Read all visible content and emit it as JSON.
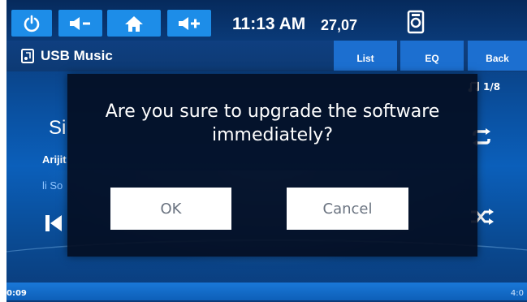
{
  "topbar": {
    "buttons": [
      {
        "name": "power-button",
        "icon": "power-icon"
      },
      {
        "name": "volume-down-button",
        "icon": "volume-down-icon"
      },
      {
        "name": "home-button",
        "icon": "home-icon"
      },
      {
        "name": "volume-up-button",
        "icon": "volume-up-icon"
      }
    ],
    "time": "11:13 AM",
    "temperature": "27,07",
    "device_icon": "media-device-icon"
  },
  "subbar": {
    "source_label": "USB Music",
    "source_icon": "music-file-icon",
    "tabs": [
      {
        "label": "List"
      },
      {
        "label": "EQ"
      },
      {
        "label": "Back"
      }
    ]
  },
  "player": {
    "track_count": "1/8",
    "title_partial": "Si",
    "artist_partial": "Arijit",
    "album_partial": "li So",
    "time_elapsed": "0:09",
    "time_total": "4:0",
    "icons": [
      "music-note-icon",
      "repeat-icon",
      "shuffle-icon",
      "previous-track-icon"
    ]
  },
  "dialog": {
    "message": "Are you sure to upgrade the software immediately?",
    "ok_label": "OK",
    "cancel_label": "Cancel"
  },
  "colors": {
    "accent": "#1d8de8",
    "dialog_bg": "#040e22",
    "button_text": "#6a7380"
  }
}
